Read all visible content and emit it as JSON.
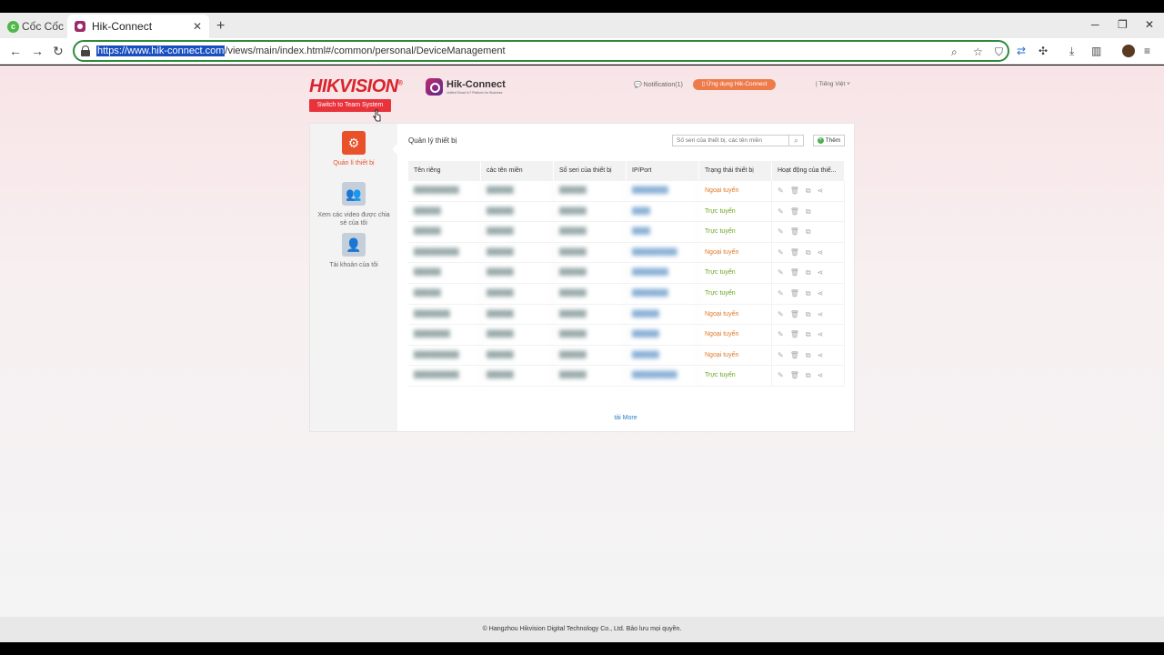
{
  "browser": {
    "brand": "Cốc Cốc",
    "tab_title": "Hik-Connect",
    "url_host": "https://www.hik-connect.com",
    "url_rest": "/views/main/index.html#/common/personal/DeviceManagement"
  },
  "header": {
    "hikvision_logo": "HIKVISION",
    "hikconnect_name": "Hik-Connect",
    "hikconnect_tagline": "Unified Smart IoT Platform for Business",
    "switch_button": "Switch to Team System",
    "notification": "Notification(1)",
    "app_button": "Ứng dụng Hik-Connect",
    "language": "Tiếng Việt"
  },
  "sidebar": {
    "items": [
      {
        "label": "Quản lí thiết bị",
        "icon": "gear-icon",
        "active": true
      },
      {
        "label": "Xem các video được chia sẻ của tôi",
        "icon": "shared-users-icon",
        "active": false
      },
      {
        "label": "Tài khoản của tôi",
        "icon": "account-icon",
        "active": false
      }
    ]
  },
  "main": {
    "title": "Quản lý thiết bị",
    "search_placeholder": "Số seri của thiết bị, các tên miền",
    "add_label": "Thêm",
    "columns": [
      "Tên riêng",
      "các tên miền",
      "Số seri của thiết bị",
      "IP/Port",
      "Trạng thái thiết bị",
      "Hoạt động của thiế..."
    ],
    "rows": [
      {
        "name": "██████████",
        "domain": "██████",
        "serial": "██████",
        "ip": "████████",
        "status": "Ngoại tuyến",
        "offline": true,
        "share": true
      },
      {
        "name": "██████",
        "domain": "██████",
        "serial": "██████",
        "ip": "████",
        "status": "Trực tuyến",
        "offline": false,
        "share": false
      },
      {
        "name": "██████",
        "domain": "██████",
        "serial": "██████",
        "ip": "████",
        "status": "Trực tuyến",
        "offline": false,
        "share": false
      },
      {
        "name": "██████████",
        "domain": "██████",
        "serial": "██████",
        "ip": "██████████",
        "status": "Ngoại tuyến",
        "offline": true,
        "share": true
      },
      {
        "name": "██████",
        "domain": "██████",
        "serial": "██████",
        "ip": "████████",
        "status": "Trực tuyến",
        "offline": false,
        "share": true
      },
      {
        "name": "██████",
        "domain": "██████",
        "serial": "██████",
        "ip": "████████",
        "status": "Trực tuyến",
        "offline": false,
        "share": true
      },
      {
        "name": "████████",
        "domain": "██████",
        "serial": "██████",
        "ip": "██████",
        "status": "Ngoại tuyến",
        "offline": true,
        "share": true
      },
      {
        "name": "████████",
        "domain": "██████",
        "serial": "██████",
        "ip": "██████",
        "status": "Ngoại tuyến",
        "offline": true,
        "share": true
      },
      {
        "name": "██████████",
        "domain": "██████",
        "serial": "██████",
        "ip": "██████",
        "status": "Ngoại tuyến",
        "offline": true,
        "share": true
      },
      {
        "name": "██████████",
        "domain": "██████",
        "serial": "██████",
        "ip": "██████████",
        "status": "Trực tuyến",
        "offline": false,
        "share": true
      }
    ],
    "load_more": "tải More"
  },
  "footer": {
    "copyright": "© Hangzhou Hikvision Digital Technology Co., Ltd. Bảo lưu mọi quyền."
  },
  "colors": {
    "accent_red": "#e8333d",
    "accent_orange": "#e8512a",
    "status_online": "#6aa422",
    "status_offline": "#e07a2a",
    "url_border": "#2e8b3a"
  }
}
